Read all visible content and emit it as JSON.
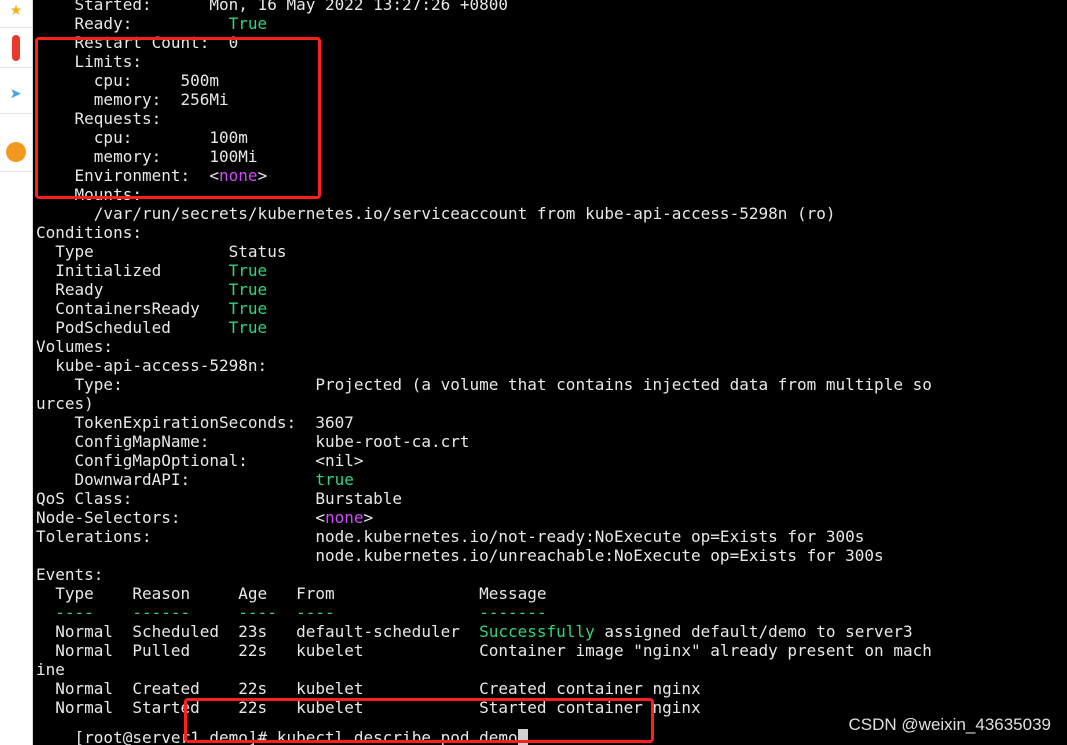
{
  "sidebar": {
    "icons": [
      "star-icon",
      "red-badge-icon",
      "paper-plane-icon",
      "palette-icon"
    ],
    "colors": {
      "star": "#f2b21b",
      "badge": "#e83b2b",
      "plane": "#4aa3e6",
      "palette": "#f19a1f"
    }
  },
  "colors": {
    "background": "#000000",
    "text": "#e8e8e8",
    "green": "#2fd67a",
    "magenta": "#d24cff",
    "highlight": "#ff1f1f"
  },
  "terminal": {
    "lines": [
      [
        {
          "t": "    Started:      Mon, 16 May 2022 13:27:26 +0800"
        }
      ],
      [
        {
          "t": "    Ready:          "
        },
        {
          "t": "True",
          "c": "green"
        }
      ],
      [
        {
          "t": "    Restart Count:  0"
        }
      ],
      [
        {
          "t": "    Limits:"
        }
      ],
      [
        {
          "t": "      cpu:     500m"
        }
      ],
      [
        {
          "t": "      memory:  256Mi"
        }
      ],
      [
        {
          "t": "    Requests:"
        }
      ],
      [
        {
          "t": "      cpu:        100m"
        }
      ],
      [
        {
          "t": "      memory:     100Mi"
        }
      ],
      [
        {
          "t": "    Environment:  <"
        },
        {
          "t": "none",
          "c": "magenta"
        },
        {
          "t": ">"
        }
      ],
      [
        {
          "t": "    Mounts:"
        }
      ],
      [
        {
          "t": "      /var/run/secrets/kubernetes.io/serviceaccount from kube-api-access-5298n (ro)"
        }
      ],
      [
        {
          "t": "Conditions:"
        }
      ],
      [
        {
          "t": "  Type              Status"
        }
      ],
      [
        {
          "t": "  Initialized       "
        },
        {
          "t": "True",
          "c": "green"
        }
      ],
      [
        {
          "t": "  Ready             "
        },
        {
          "t": "True",
          "c": "green"
        }
      ],
      [
        {
          "t": "  ContainersReady   "
        },
        {
          "t": "True",
          "c": "green"
        }
      ],
      [
        {
          "t": "  PodScheduled      "
        },
        {
          "t": "True",
          "c": "green"
        }
      ],
      [
        {
          "t": "Volumes:"
        }
      ],
      [
        {
          "t": "  kube-api-access-5298n:"
        }
      ],
      [
        {
          "t": "    Type:                    Projected (a volume that contains injected data from multiple so"
        }
      ],
      [
        {
          "t": "urces)"
        }
      ],
      [
        {
          "t": "    TokenExpirationSeconds:  3607"
        }
      ],
      [
        {
          "t": "    ConfigMapName:           kube-root-ca.crt"
        }
      ],
      [
        {
          "t": "    ConfigMapOptional:       <nil>"
        }
      ],
      [
        {
          "t": "    DownwardAPI:             "
        },
        {
          "t": "true",
          "c": "green"
        }
      ],
      [
        {
          "t": "QoS Class:                   Burstable"
        }
      ],
      [
        {
          "t": "Node-Selectors:              <"
        },
        {
          "t": "none",
          "c": "magenta"
        },
        {
          "t": ">"
        }
      ],
      [
        {
          "t": "Tolerations:                 node.kubernetes.io/not-ready:NoExecute op=Exists for 300s"
        }
      ],
      [
        {
          "t": "                             node.kubernetes.io/unreachable:NoExecute op=Exists for 300s"
        }
      ],
      [
        {
          "t": "Events:"
        }
      ],
      [
        {
          "t": "  Type    Reason     Age   From               Message"
        }
      ],
      [
        {
          "t": "  ----    ------     ----  ----               -------",
          "c": "green"
        }
      ],
      [
        {
          "t": "  Normal  Scheduled  23s   default-scheduler  "
        },
        {
          "t": "Successfully",
          "c": "green"
        },
        {
          "t": " assigned default/demo to server3"
        }
      ],
      [
        {
          "t": "  Normal  Pulled     22s   kubelet            Container image \"nginx\" already present on mach"
        }
      ],
      [
        {
          "t": "ine"
        }
      ],
      [
        {
          "t": "  Normal  Created    22s   kubelet            Created container nginx"
        }
      ],
      [
        {
          "t": "  Normal  Started    22s   kubelet            Started container nginx"
        }
      ]
    ],
    "prompt": "[root@server1 demo]# ",
    "command": "kubectl describe pod demo"
  },
  "watermark": "CSDN @weixin_43635039"
}
